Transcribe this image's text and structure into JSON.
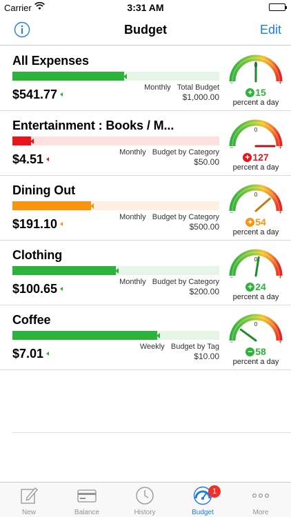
{
  "status_bar": {
    "carrier": "Carrier",
    "time": "3:31 AM"
  },
  "nav": {
    "title": "Budget",
    "edit_label": "Edit"
  },
  "colors": {
    "accent": "#1a7be8",
    "green": "#2db33c",
    "red": "#e8161c",
    "orange": "#f7950e"
  },
  "budgets": [
    {
      "name": "All Expenses",
      "spent": "$541.77",
      "period": "Monthly",
      "type": "Total Budget",
      "limit": "$1,000.00",
      "fill": 0.54,
      "color": "green",
      "gauge_sign": "+",
      "gauge_value": "15",
      "gauge_level": 0.5,
      "gauge_caption": "percent a day"
    },
    {
      "name": "Entertainment : Books / M...",
      "spent": "$4.51",
      "period": "Monthly",
      "type": "Budget by Category",
      "limit": "$50.00",
      "fill": 0.09,
      "color": "red",
      "gauge_sign": "+",
      "gauge_value": "127",
      "gauge_level": 1.0,
      "gauge_caption": "percent a day"
    },
    {
      "name": "Dining Out",
      "spent": "$191.10",
      "period": "Monthly",
      "type": "Budget by Category",
      "limit": "$500.00",
      "fill": 0.38,
      "color": "orange",
      "gauge_sign": "+",
      "gauge_value": "54",
      "gauge_level": 0.77,
      "gauge_caption": "percent a day"
    },
    {
      "name": "Clothing",
      "spent": "$100.65",
      "period": "Monthly",
      "type": "Budget by Category",
      "limit": "$200.00",
      "fill": 0.5,
      "color": "green",
      "gauge_sign": "+",
      "gauge_value": "24",
      "gauge_level": 0.55,
      "gauge_caption": "percent a day"
    },
    {
      "name": "Coffee",
      "spent": "$7.01",
      "period": "Weekly",
      "type": "Budget by Tag",
      "limit": "$10.00",
      "fill": 0.7,
      "color": "green",
      "gauge_sign": "−",
      "gauge_value": "58",
      "gauge_level": 0.2,
      "gauge_caption": "percent a day"
    }
  ],
  "gauge_zero": "0",
  "tabs": [
    {
      "label": "New",
      "icon": "compose-icon"
    },
    {
      "label": "Balance",
      "icon": "card-icon"
    },
    {
      "label": "History",
      "icon": "clock-icon"
    },
    {
      "label": "Budget",
      "icon": "gauge-icon",
      "badge": "1",
      "active": true
    },
    {
      "label": "More",
      "icon": "more-icon"
    }
  ]
}
